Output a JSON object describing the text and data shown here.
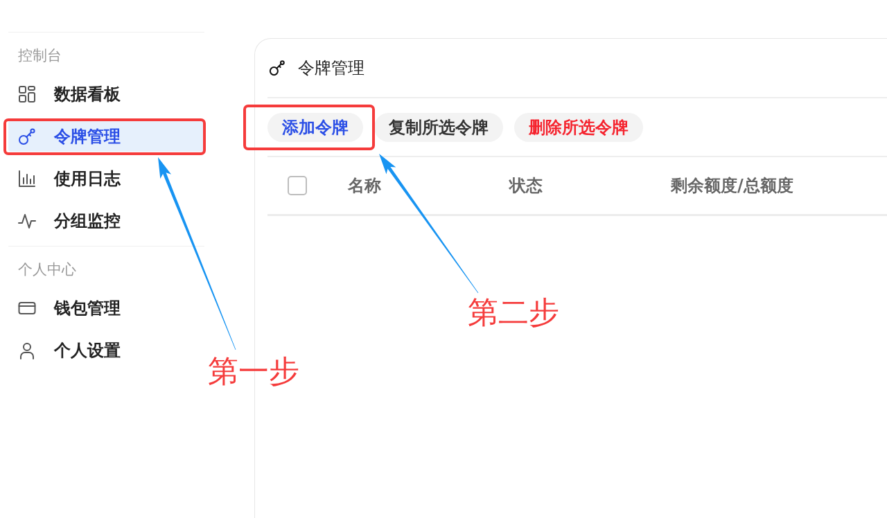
{
  "sidebar": {
    "sections": [
      {
        "title": "控制台",
        "items": [
          {
            "label": "数据看板",
            "selected": false
          },
          {
            "label": "令牌管理",
            "selected": true
          },
          {
            "label": "使用日志",
            "selected": false
          },
          {
            "label": "分组监控",
            "selected": false
          }
        ]
      },
      {
        "title": "个人中心",
        "items": [
          {
            "label": "钱包管理",
            "selected": false
          },
          {
            "label": "个人设置",
            "selected": false
          }
        ]
      }
    ]
  },
  "panel": {
    "title": "令牌管理",
    "actions": [
      {
        "label": "添加令牌",
        "kind": "primary"
      },
      {
        "label": "复制所选令牌",
        "kind": "default"
      },
      {
        "label": "删除所选令牌",
        "kind": "danger"
      }
    ]
  },
  "table": {
    "select_all": {
      "checked": false
    },
    "columns": [
      "名称",
      "状态",
      "剩余额度/总额度"
    ]
  },
  "annotations": [
    {
      "label": "第一步"
    },
    {
      "label": "第二步"
    }
  ]
}
